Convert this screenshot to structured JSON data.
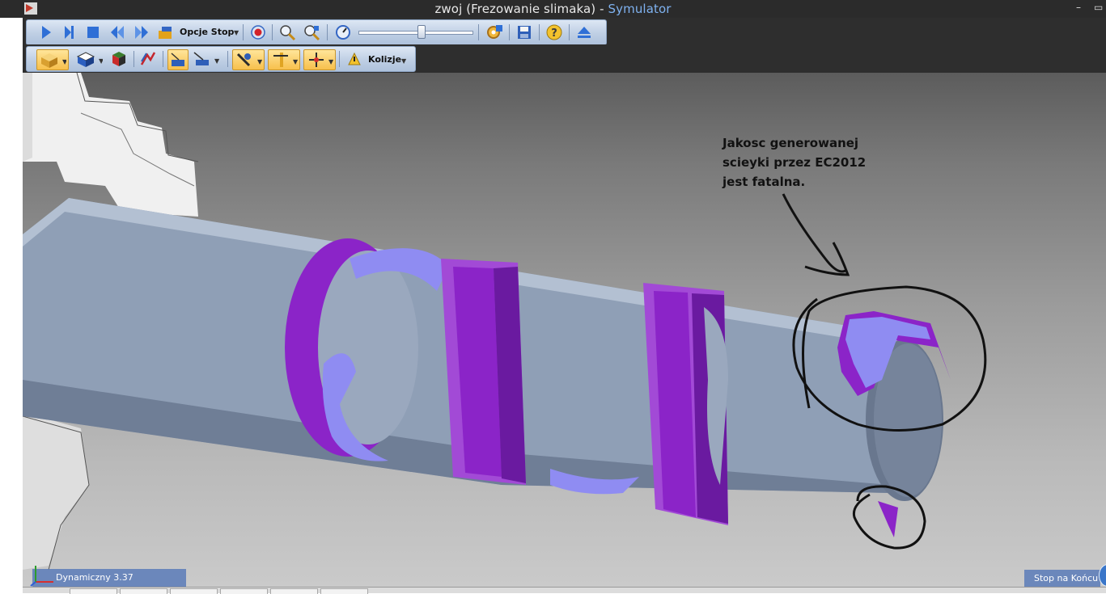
{
  "window": {
    "title_prefix": "zwoj (Frezowanie slimaka) - ",
    "title_app": "Symulator",
    "minimize_glyph": "–",
    "restore_glyph": "▭"
  },
  "toolbar1": {
    "stop_options_label": "Opcje Stop",
    "speed_slider_value": 0.55,
    "icons": [
      "play-icon",
      "step-icon",
      "stop-icon",
      "rewind-icon",
      "fast-forward-icon",
      "stop-options-icon",
      "record-icon",
      "zoom-icon",
      "zoom-fit-icon",
      "speed-icon",
      "settings-icon",
      "save-icon",
      "help-icon",
      "eject-icon"
    ]
  },
  "toolbar2": {
    "collisions_label": "Kolizje",
    "icons": [
      "stock-view-icon",
      "part-view-icon",
      "fixture-view-icon",
      "toolpath-icon",
      "view-plane-icon",
      "view-section-icon",
      "tool-display-icon",
      "tool-holder-icon",
      "tool-axis-icon",
      "collisions-icon"
    ]
  },
  "annotation": {
    "line1": "Jakosc generowanej",
    "line2": "scieyki przez EC2012",
    "line3": "jest fatalna."
  },
  "status": {
    "mode_label": "Dynamiczny 3.37",
    "stop_label": "Stop na Końcu"
  },
  "colors": {
    "accent_title": "#7fb2f0",
    "magenta": "#8b24c8",
    "tool_blue": "#8f8cf2",
    "shaft": "#8f9fb6",
    "status_bg": "#5b7bb8"
  }
}
